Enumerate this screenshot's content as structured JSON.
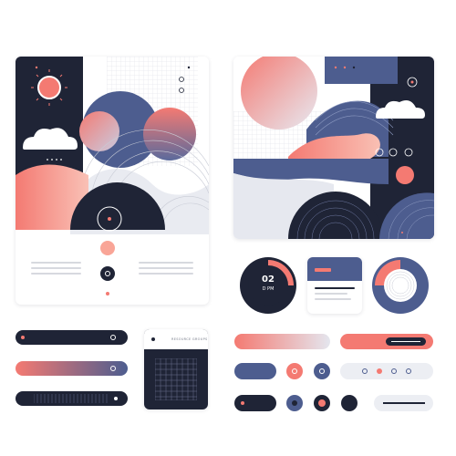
{
  "colors": {
    "navy": "#1f2436",
    "slate": "#4d5d8f",
    "coral": "#f47a72",
    "peach": "#f9a597",
    "light": "#eef0f5",
    "white": "#ffffff"
  },
  "center_widget": {
    "time_label": "02",
    "period_label": "D PM"
  },
  "small_card": {
    "title": "RESOURCE GROUPS"
  },
  "icons": {
    "sun": "sun-icon",
    "cloud": "cloud-icon",
    "record": "record-icon"
  }
}
